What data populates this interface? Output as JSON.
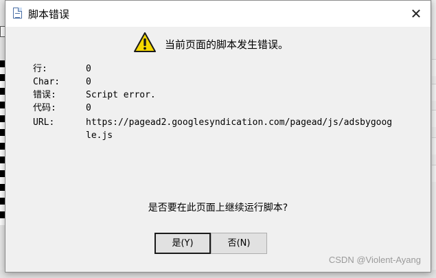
{
  "dialog": {
    "title": "脚本错误",
    "close_glyph": "✕",
    "header_message": "当前页面的脚本发生错误。",
    "details": [
      {
        "key": "行:",
        "value": "0"
      },
      {
        "key": "Char:",
        "value": "0"
      },
      {
        "key": "错误:",
        "value": "Script error."
      },
      {
        "key": "代码:",
        "value": "0"
      },
      {
        "key": "URL:",
        "value": "https://pagead2.googlesyndication.com/pagead/js/adsbygoogle.js"
      }
    ],
    "question": "是否要在此页面上继续运行脚本?",
    "yes_label": "是(Y)",
    "no_label": "否(N)"
  },
  "watermark": "CSDN @Violent-Ayang",
  "icons": {
    "warning": "warning-icon",
    "title": "script-document-icon"
  },
  "colors": {
    "warning_fill": "#f5d800",
    "dialog_body": "#f0f0f0",
    "button_face": "#e1e1e1"
  }
}
